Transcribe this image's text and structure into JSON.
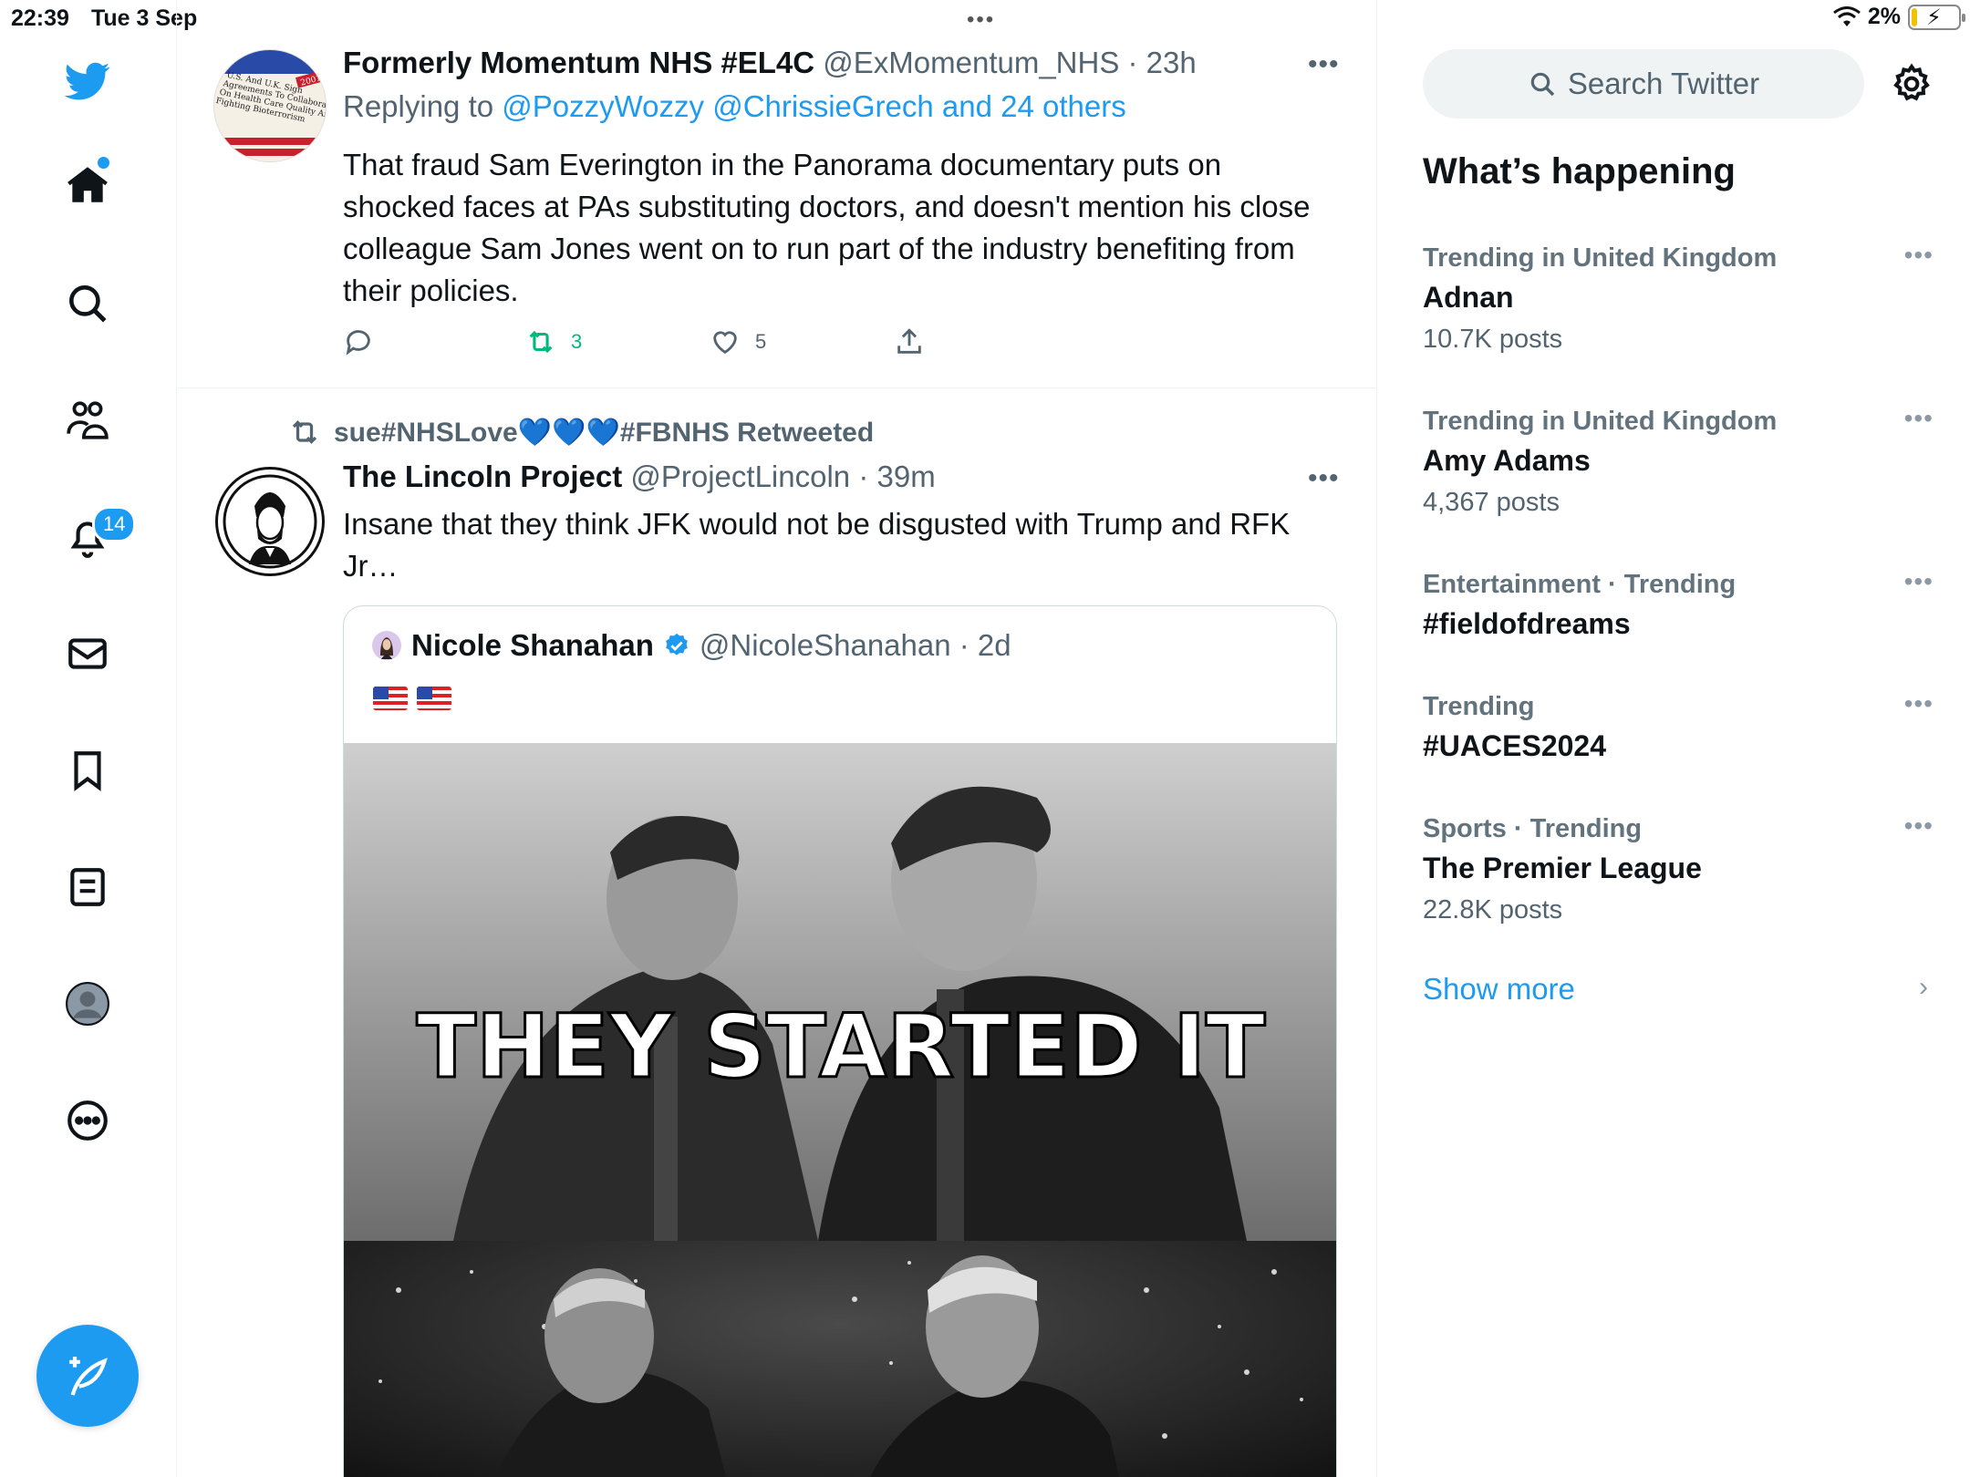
{
  "status_bar": {
    "time": "22:39",
    "date": "Tue 3 Sep",
    "battery": "2%"
  },
  "nav": {
    "notifications_badge": "14",
    "icons": [
      "twitter-bird-icon",
      "home-icon",
      "search-icon",
      "communities-icon",
      "notifications-icon",
      "messages-icon",
      "bookmarks-icon",
      "lists-icon",
      "profile-icon",
      "more-icon",
      "compose-icon"
    ]
  },
  "tweet1": {
    "author_name": "Formerly Momentum NHS #EL4C",
    "handle_time": "@ExMomentum_NHS · 23h",
    "reply_prefix": "Replying to ",
    "reply_targets": "@PozzyWozzy @ChrissieGrech and 24 others",
    "text": "That fraud Sam Everington in the Panorama documentary puts on shocked faces at PAs substituting doctors, and doesn't mention his close colleague Sam Jones went on to run part of the industry benefiting from their policies.",
    "retweets": "3",
    "likes": "5",
    "avatar_text": "U.S. And U.K. Sign Agreements To Collaborate On Health Care Quality And Fighting Bioterrorism",
    "avatar_year": "2001"
  },
  "tweet2": {
    "retweeted_by": "sue#NHSLove💙💙💙#FBNHS Retweeted",
    "author_name": "The Lincoln Project",
    "handle_time": "@ProjectLincoln · 39m",
    "text": "Insane that they think JFK would not be disgusted with Trump and RFK Jr…",
    "quote": {
      "author_name": "Nicole Shanahan",
      "handle_time": "@NicoleShanahan · 2d",
      "image_caption": "THEY STARTED IT"
    }
  },
  "sidebar": {
    "search_placeholder": "Search Twitter",
    "section_title": "What’s happening",
    "trends": [
      {
        "context": "Trending in United Kingdom",
        "topic": "Adnan",
        "count": "10.7K posts"
      },
      {
        "context": "Trending in United Kingdom",
        "topic": "Amy Adams",
        "count": "4,367 posts"
      },
      {
        "context": "Entertainment · Trending",
        "topic": "#fieldofdreams",
        "count": ""
      },
      {
        "context": "Trending",
        "topic": "#UACES2024",
        "count": ""
      },
      {
        "context": "Sports · Trending",
        "topic": "The Premier League",
        "count": "22.8K posts"
      }
    ],
    "show_more": "Show more"
  },
  "colors": {
    "accent": "#1d9bf0",
    "retweet_green": "#00ba7c",
    "secondary_text": "#536471"
  }
}
